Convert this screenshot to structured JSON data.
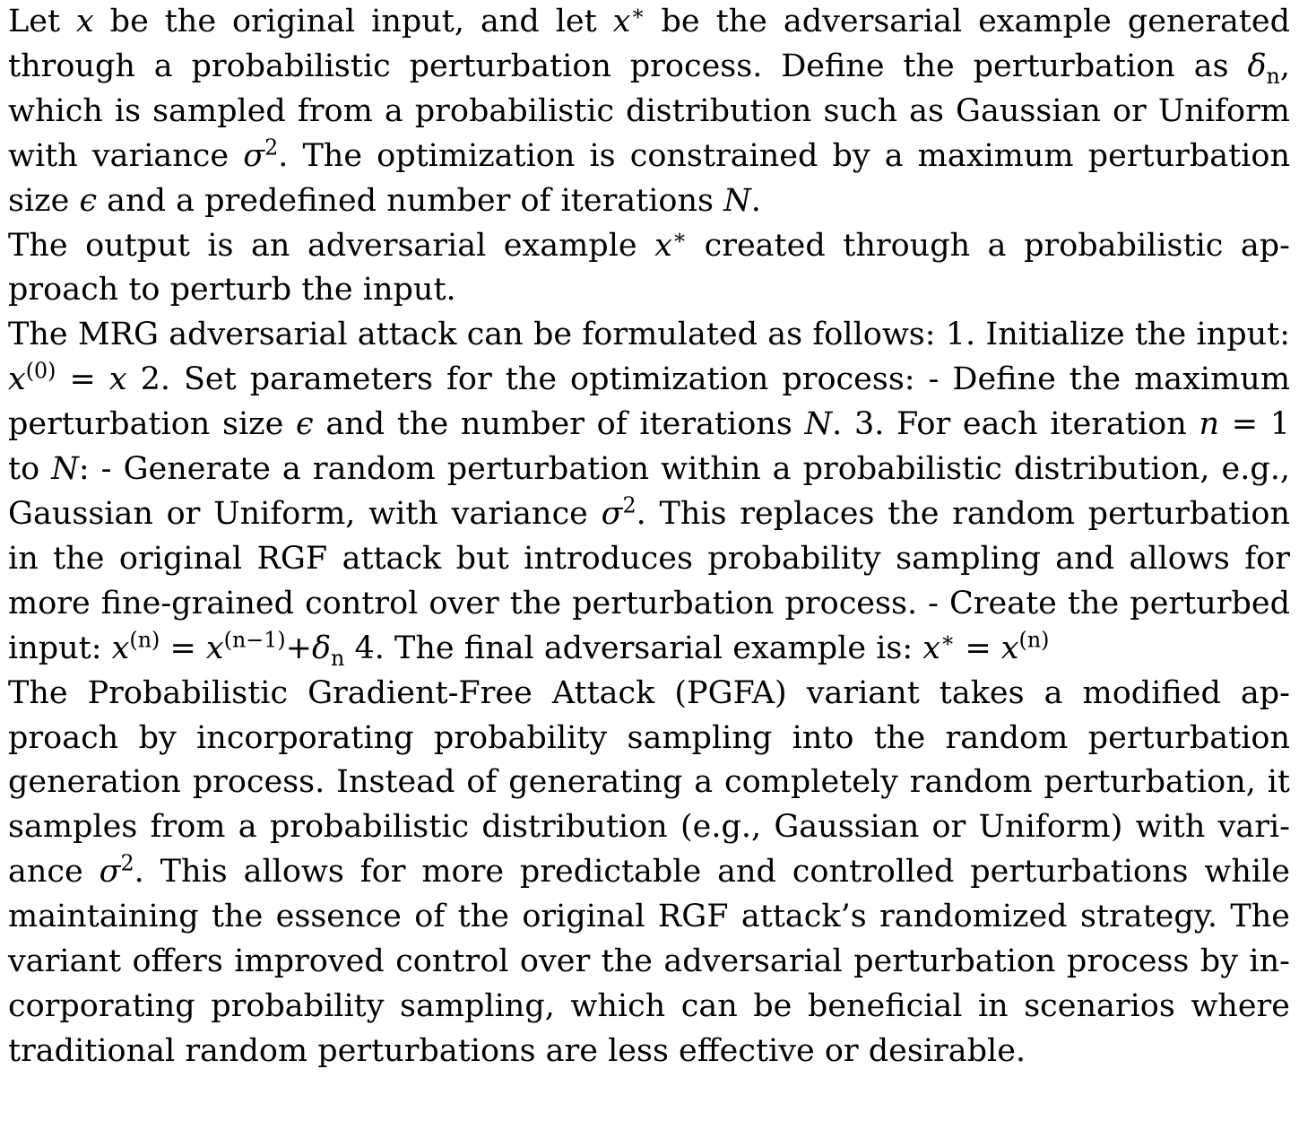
{
  "paragraphs": [
    [
      {
        "t": "Let "
      },
      {
        "m": "x"
      },
      {
        "t": " be the original input, and let "
      },
      {
        "m": "x"
      },
      {
        "sup": "∗"
      },
      {
        "t": " be the adversarial example generated through a probabilistic perturbation process.  Define the perturbation as "
      },
      {
        "m": "δ"
      },
      {
        "sub": "n"
      },
      {
        "t": ", which is sampled from a probabilistic distribution such as Gaussian or Uniform with variance "
      },
      {
        "m": "σ"
      },
      {
        "sup": "2"
      },
      {
        "t": ". The optimization is constrained by a maximum perturbation size "
      },
      {
        "m": "ϵ"
      },
      {
        "t": " and a predefined number of iterations "
      },
      {
        "m": "N"
      },
      {
        "t": "."
      }
    ],
    [
      {
        "t": "The output is an adversarial example "
      },
      {
        "m": "x"
      },
      {
        "sup": "∗"
      },
      {
        "t": " created through a probabilistic ap­proach to perturb the input."
      }
    ],
    [
      {
        "t": "The MRG adversarial attack can be formulated as follows:  1.  Initialize the input:  "
      },
      {
        "m": "x"
      },
      {
        "sup": "(0)"
      },
      {
        "t": " = "
      },
      {
        "m": "x"
      },
      {
        "t": " 2.  Set parameters for the optimization process:  - Define the maximum perturbation size "
      },
      {
        "m": "ϵ"
      },
      {
        "t": " and the number of iterations "
      },
      {
        "m": "N"
      },
      {
        "t": ".  3.  For each iteration "
      },
      {
        "m": "n"
      },
      {
        "t": " = 1 to "
      },
      {
        "m": "N"
      },
      {
        "t": ": - Generate a random perturbation within a probabilistic distribution, e.g., Gaussian or Uniform, with variance "
      },
      {
        "m": "σ"
      },
      {
        "sup": "2"
      },
      {
        "t": ".  This replaces the random perturbation in the original RGF attack but introduces probability sampling and allows for more fine-grained control over the perturbation process. - Create the perturbed input: "
      },
      {
        "m": "x"
      },
      {
        "sup": "(n)"
      },
      {
        "t": " = "
      },
      {
        "m": "x"
      },
      {
        "sup": "(n−1)"
      },
      {
        "t": "+"
      },
      {
        "m": "δ"
      },
      {
        "sub": "n"
      },
      {
        "t": " 4. The final adversarial example is: "
      },
      {
        "m": "x"
      },
      {
        "sup": "∗"
      },
      {
        "t": " = "
      },
      {
        "m": "x"
      },
      {
        "sup": "(n)"
      }
    ],
    [
      {
        "t": "The Probabilistic Gradient-Free Attack (PGFA) variant takes a modified ap­proach by incorporating probability sampling into the random perturbation generation process. Instead of generating a completely random perturbation, it samples from a probabilistic distribution (e.g., Gaussian or Uniform) with vari­ance "
      },
      {
        "m": "σ"
      },
      {
        "sup": "2"
      },
      {
        "t": ".  This allows for more predictable and controlled perturbations while maintaining the essence of the original RGF attack’s randomized strategy. The variant offers improved control over the adversarial perturbation process by in­corporating probability sampling, which can be beneficial in scenarios where traditional random perturbations are less effective or desirable."
      }
    ]
  ]
}
